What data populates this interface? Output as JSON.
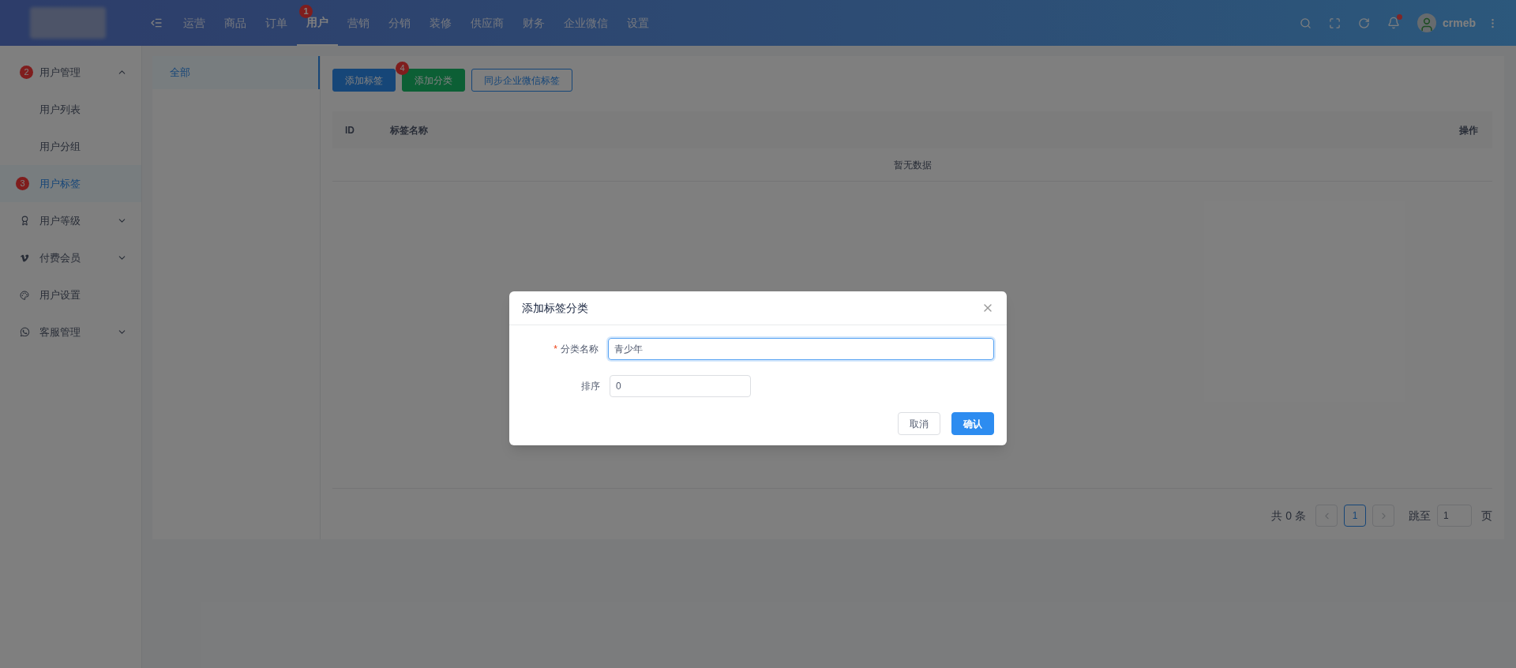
{
  "header": {
    "nav": [
      {
        "label": "运营",
        "selected": false
      },
      {
        "label": "商品",
        "selected": false
      },
      {
        "label": "订单",
        "selected": false
      },
      {
        "label": "用户",
        "selected": true,
        "step": "1"
      },
      {
        "label": "营销",
        "selected": false
      },
      {
        "label": "分销",
        "selected": false
      },
      {
        "label": "装修",
        "selected": false
      },
      {
        "label": "供应商",
        "selected": false
      },
      {
        "label": "财务",
        "selected": false
      },
      {
        "label": "企业微信",
        "selected": false
      },
      {
        "label": "设置",
        "selected": false
      }
    ],
    "notification_dot": true,
    "username": "crmeb"
  },
  "sidebar": {
    "items": [
      {
        "label": "用户管理",
        "kind": "badge",
        "step": "2",
        "expanded": true,
        "children": [
          {
            "label": "用户列表",
            "selected": false
          },
          {
            "label": "用户分组",
            "selected": false
          },
          {
            "label": "用户标签",
            "selected": true,
            "step": "3"
          }
        ]
      },
      {
        "label": "用户等级",
        "kind": "award",
        "expanded": false
      },
      {
        "label": "付费会员",
        "kind": "vip",
        "expanded": false
      },
      {
        "label": "用户设置",
        "kind": "palette"
      },
      {
        "label": "客服管理",
        "kind": "chat",
        "expanded": false
      }
    ]
  },
  "categories": [
    {
      "label": "全部",
      "selected": true
    }
  ],
  "toolbar": [
    {
      "label": "添加标签",
      "kind": "primary"
    },
    {
      "label": "添加分类",
      "kind": "success",
      "step": "4"
    },
    {
      "label": "同步企业微信标签",
      "kind": "outline"
    }
  ],
  "table": {
    "columns": [
      "ID",
      "标签名称",
      "操作"
    ],
    "empty_text": "暂无数据"
  },
  "pagination": {
    "total": "共 0 条",
    "pages": [
      {
        "label": "1",
        "selected": true
      }
    ],
    "jump_label": "跳至",
    "jump_value": "1",
    "page_unit": "页"
  },
  "dialog": {
    "title": "添加标签分类",
    "required_mark": "*",
    "fields": [
      {
        "label": "分类名称",
        "required": true,
        "value": "青少年",
        "focused": true
      },
      {
        "label": "排序",
        "required": false,
        "value": "0",
        "focused": false
      }
    ],
    "buttons": [
      {
        "label": "取消",
        "kind": "default"
      },
      {
        "label": "确认",
        "kind": "primary"
      }
    ]
  }
}
